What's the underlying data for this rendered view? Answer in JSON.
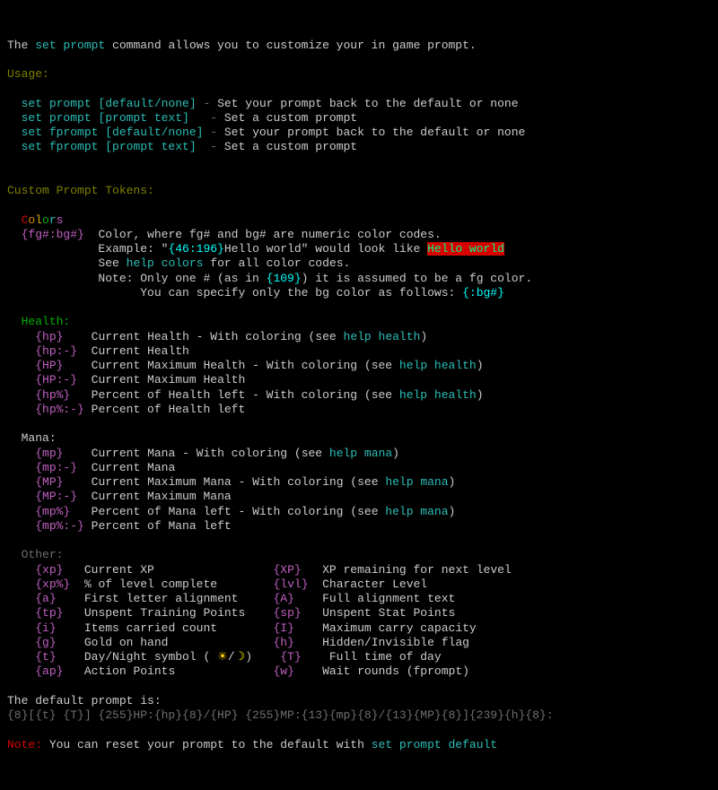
{
  "intro": {
    "pre": "The ",
    "cmd": "set prompt",
    "post": " command allows you to customize your in game prompt."
  },
  "usage_label": "Usage:",
  "usage": [
    {
      "cmd": "set prompt [default/none]",
      "sep": " - ",
      "desc": "Set your prompt back to the default or none"
    },
    {
      "cmd": "set prompt [prompt text]",
      "gap": "  ",
      "sep": " - ",
      "desc": "Set a custom prompt"
    },
    {
      "cmd": "set fprompt [default/none]",
      "sep": " - ",
      "desc": "Set your prompt back to the default or none"
    },
    {
      "cmd": "set fprompt [prompt text]",
      "gap": " ",
      "sep": " - ",
      "desc": "Set a custom prompt"
    }
  ],
  "tokens_label": "Custom Prompt Tokens:",
  "colors_word": [
    "C",
    "o",
    "l",
    "o",
    "r",
    "s"
  ],
  "colors": {
    "token": "{fg#:bg#}",
    "line1": "Color, where fg# and bg# are numeric color codes.",
    "ex_pre": "Example: \"",
    "ex_tok": "{46:196}",
    "ex_mid": "Hello world\" would look like ",
    "ex_demo": "Hello world",
    "see_pre": "See ",
    "help_colors": "help colors",
    "see_post": " for all color codes.",
    "note_pre": "Note: Only one # (as in ",
    "note_tok": "{109}",
    "note_post": ") it is assumed to be a fg color.",
    "note2_pre": "You can specify only the bg color as follows: ",
    "note2_tok": "{:bg#}"
  },
  "health": {
    "label": "Health:",
    "rows": [
      {
        "tok": "{hp}",
        "gap": "    ",
        "desc_pre": "Current Health - With coloring (see ",
        "help": "help health",
        "desc_post": ")"
      },
      {
        "tok": "{hp:-}",
        "gap": "  ",
        "desc": "Current Health"
      },
      {
        "tok": "{HP}",
        "gap": "    ",
        "desc_pre": "Current Maximum Health - With coloring (see ",
        "help": "help health",
        "desc_post": ")"
      },
      {
        "tok": "{HP:-}",
        "gap": "  ",
        "desc": "Current Maximum Health"
      },
      {
        "tok": "{hp%}",
        "gap": "   ",
        "desc_pre": "Percent of Health left - With coloring (see ",
        "help": "help health",
        "desc_post": ")"
      },
      {
        "tok": "{hp%:-}",
        "gap": " ",
        "desc": "Percent of Health left"
      }
    ]
  },
  "mana": {
    "label": "Mana:",
    "rows": [
      {
        "tok": "{mp}",
        "gap": "    ",
        "desc_pre": "Current Mana - With coloring (see ",
        "help": "help mana",
        "desc_post": ")"
      },
      {
        "tok": "{mp:-}",
        "gap": "  ",
        "desc": "Current Mana"
      },
      {
        "tok": "{MP}",
        "gap": "    ",
        "desc_pre": "Current Maximum Mana - With coloring (see ",
        "help": "help mana",
        "desc_post": ")"
      },
      {
        "tok": "{MP:-}",
        "gap": "  ",
        "desc": "Current Maximum Mana"
      },
      {
        "tok": "{mp%}",
        "gap": "   ",
        "desc_pre": "Percent of Mana left - With coloring (see ",
        "help": "help mana",
        "desc_post": ")"
      },
      {
        "tok": "{mp%:-}",
        "gap": " ",
        "desc": "Percent of Mana left"
      }
    ]
  },
  "other": {
    "label": "Other:",
    "rows": [
      {
        "t1": "{xp}",
        "g1": "   ",
        "d1": "Current XP",
        "t2": "{XP}",
        "d2": "XP remaining for next level"
      },
      {
        "t1": "{xp%}",
        "g1": "  ",
        "d1": "% of level complete",
        "t2": "{lvl}",
        "d2": "Character Level"
      },
      {
        "t1": "{a}",
        "g1": "    ",
        "d1": "First letter alignment",
        "t2": "{A}",
        "d2": "Full alignment text"
      },
      {
        "t1": "{tp}",
        "g1": "   ",
        "d1": "Unspent Training Points",
        "t2": "{sp}",
        "d2": "Unspent Stat Points"
      },
      {
        "t1": "{i}",
        "g1": "    ",
        "d1": "Items carried count",
        "t2": "{I}",
        "d2": "Maximum carry capacity"
      },
      {
        "t1": "{g}",
        "g1": "    ",
        "d1": "Gold on hand",
        "t2": "{h}",
        "d2": "Hidden/Invisible flag"
      },
      {
        "t1": "{t}",
        "g1": "    ",
        "d1_pre": "Day/Night symbol ( ",
        "sun": "☀",
        "slash": "/",
        "moon": "☽",
        "d1_post": ")",
        "t2": "{T}",
        "d2": "Full time of day"
      },
      {
        "t1": "{ap}",
        "g1": "   ",
        "d1": "Action Points",
        "t2": "{w}",
        "d2": "Wait rounds (fprompt)"
      }
    ]
  },
  "default_label": "The default prompt is:",
  "default_prompt": "{8}[{t} {T}] {255}HP:{hp}{8}/{HP} {255}MP:{13}{mp}{8}/{13}{MP}{8}]{239}{h}{8}:",
  "note_label": "Note:",
  "note_body": " You can reset your prompt to the default with ",
  "note_cmd": "set prompt default"
}
